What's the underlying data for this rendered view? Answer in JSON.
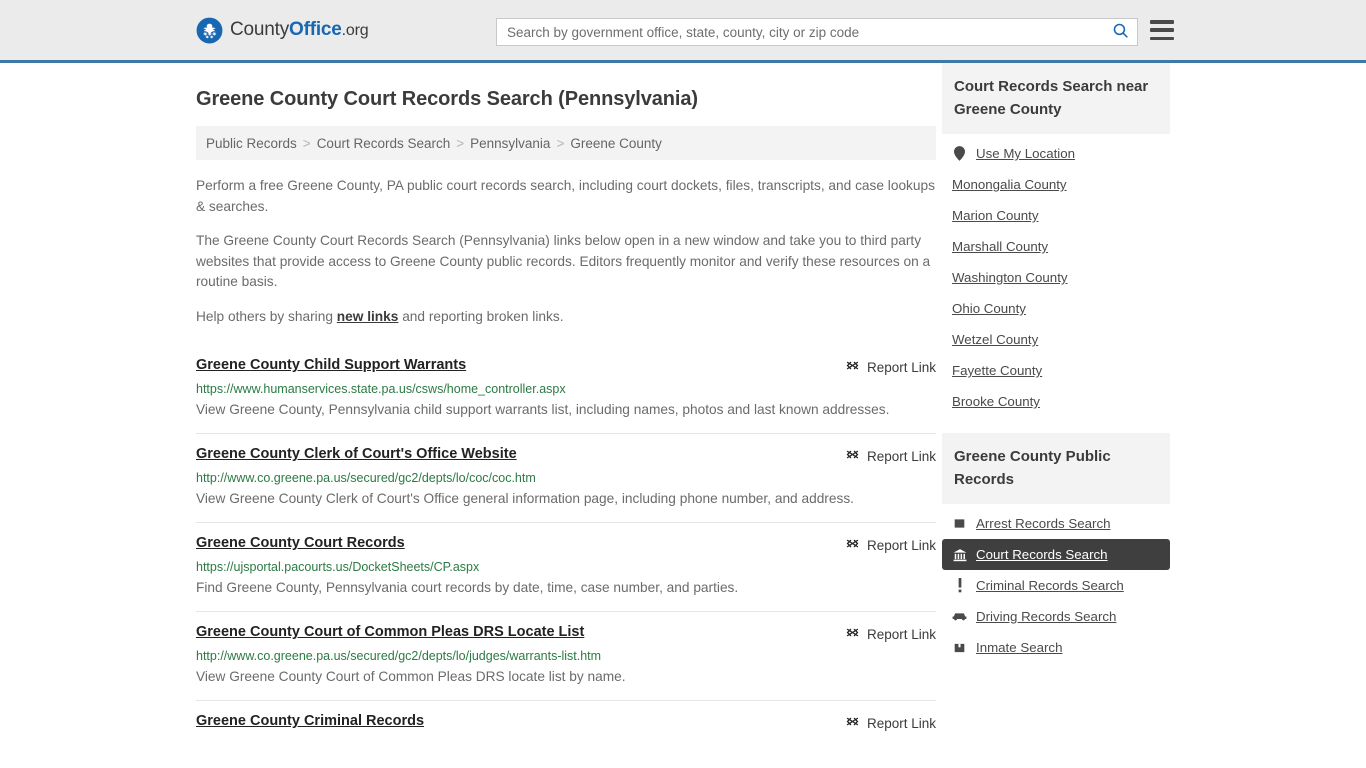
{
  "header": {
    "logo": {
      "icon": "eagle-seal-icon",
      "part1": "County",
      "part2": "Office",
      "part3": ".org"
    },
    "search": {
      "placeholder": "Search by government office, state, county, city or zip code",
      "value": "",
      "icon": "search-icon"
    },
    "menu_icon": "hamburger-menu-icon",
    "accent_color": "#3c78a8",
    "background_color": "#ebebeb"
  },
  "main": {
    "title": "Greene County Court Records Search (Pennsylvania)",
    "breadcrumb": [
      "Public Records",
      "Court Records Search",
      "Pennsylvania",
      "Greene County"
    ],
    "breadcrumb_separator": ">",
    "intro": {
      "p1": "Perform a free Greene County, PA public court records search, including court dockets, files, transcripts, and case lookups & searches.",
      "p2": "The Greene County Court Records Search (Pennsylvania) links below open in a new window and take you to third party websites that provide access to Greene County public records. Editors frequently monitor and verify these resources on a routine basis.",
      "p3_before": "Help others by sharing ",
      "p3_link": "new links",
      "p3_after": " and reporting broken links."
    },
    "report_link_label": "Report Link",
    "report_link_icon": "broken-link-icon",
    "results": [
      {
        "title": "Greene County Child Support Warrants",
        "url": "https://www.humanservices.state.pa.us/csws/home_controller.aspx",
        "description": "View Greene County, Pennsylvania child support warrants list, including names, photos and last known addresses."
      },
      {
        "title": "Greene County Clerk of Court's Office Website",
        "url": "http://www.co.greene.pa.us/secured/gc2/depts/lo/coc/coc.htm",
        "description": "View Greene County Clerk of Court's Office general information page, including phone number, and address."
      },
      {
        "title": "Greene County Court Records",
        "url": "https://ujsportal.pacourts.us/DocketSheets/CP.aspx",
        "description": "Find Greene County, Pennsylvania court records by date, time, case number, and parties."
      },
      {
        "title": "Greene County Court of Common Pleas DRS Locate List",
        "url": "http://www.co.greene.pa.us/secured/gc2/depts/lo/judges/warrants-list.htm",
        "description": "View Greene County Court of Common Pleas DRS locate list by name."
      },
      {
        "title": "Greene County Criminal Records",
        "url": "",
        "description": ""
      }
    ]
  },
  "sidebar": {
    "nearby": {
      "heading": "Court Records Search near Greene County",
      "use_my_location": {
        "label": "Use My Location",
        "icon": "map-pin-icon"
      },
      "counties": [
        "Monongalia County",
        "Marion County",
        "Marshall County",
        "Washington County",
        "Ohio County",
        "Wetzel County",
        "Fayette County",
        "Brooke County"
      ]
    },
    "public_records": {
      "heading": "Greene County Public Records",
      "items": [
        {
          "label": "Arrest Records Search",
          "icon": "square-icon",
          "active": false
        },
        {
          "label": "Court Records Search",
          "icon": "courthouse-icon",
          "active": true
        },
        {
          "label": "Criminal Records Search",
          "icon": "exclamation-icon",
          "active": false
        },
        {
          "label": "Driving Records Search",
          "icon": "car-icon",
          "active": false
        },
        {
          "label": "Inmate Search",
          "icon": "inmate-icon",
          "active": false
        }
      ]
    }
  }
}
